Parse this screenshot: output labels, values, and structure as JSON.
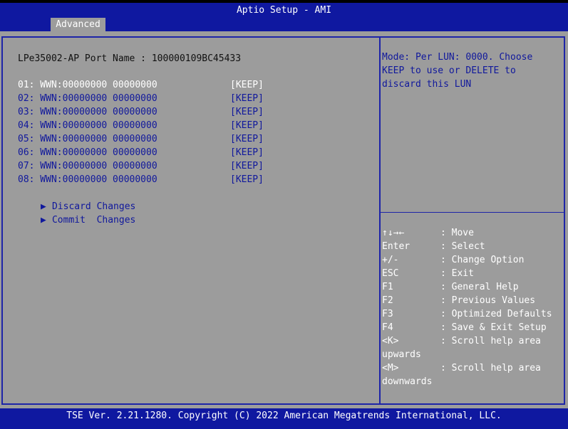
{
  "app": {
    "title": "Aptio Setup - AMI",
    "tabs": [
      {
        "label": "Advanced",
        "active": true
      }
    ]
  },
  "main": {
    "port_name": "LPe35002-AP Port Name : 100000109BC45433",
    "wwn_entries": [
      {
        "label": "01: WWN:00000000 00000000",
        "value": "[KEEP]",
        "selected": true
      },
      {
        "label": "02: WWN:00000000 00000000",
        "value": "[KEEP]"
      },
      {
        "label": "03: WWN:00000000 00000000",
        "value": "[KEEP]"
      },
      {
        "label": "04: WWN:00000000 00000000",
        "value": "[KEEP]"
      },
      {
        "label": "05: WWN:00000000 00000000",
        "value": "[KEEP]"
      },
      {
        "label": "06: WWN:00000000 00000000",
        "value": "[KEEP]"
      },
      {
        "label": "07: WWN:00000000 00000000",
        "value": "[KEEP]"
      },
      {
        "label": "08: WWN:00000000 00000000",
        "value": "[KEEP]"
      }
    ],
    "submenus": [
      {
        "arrow": "▶",
        "label": "Discard Changes"
      },
      {
        "arrow": "▶",
        "label": "Commit  Changes"
      }
    ]
  },
  "help": {
    "text": "Mode: Per LUN: 0000. Choose KEEP to use or DELETE to discard this LUN"
  },
  "keys": [
    {
      "key": "↑↓→←",
      "desc": ": Move"
    },
    {
      "key": "Enter",
      "desc": ": Select"
    },
    {
      "key": "+/-",
      "desc": ": Change Option"
    },
    {
      "key": "ESC",
      "desc": ": Exit"
    },
    {
      "key": "F1",
      "desc": ": General Help"
    },
    {
      "key": "F2",
      "desc": ": Previous Values"
    },
    {
      "key": "F3",
      "desc": ": Optimized Defaults"
    },
    {
      "key": "F4",
      "desc": ": Save & Exit Setup"
    },
    {
      "key": "<K>",
      "desc": ": Scroll help area",
      "wrap": "upwards"
    },
    {
      "key": "<M>",
      "desc": ": Scroll help area",
      "wrap": "downwards"
    }
  ],
  "footer": {
    "text": "TSE Ver. 2.21.1280. Copyright (C) 2022 American Megatrends International, LLC."
  },
  "colors": {
    "background_blue": "#0f18a0",
    "panel_gray": "#9c9c9c",
    "text_white": "#ffffff",
    "text_blue": "#10189c"
  }
}
